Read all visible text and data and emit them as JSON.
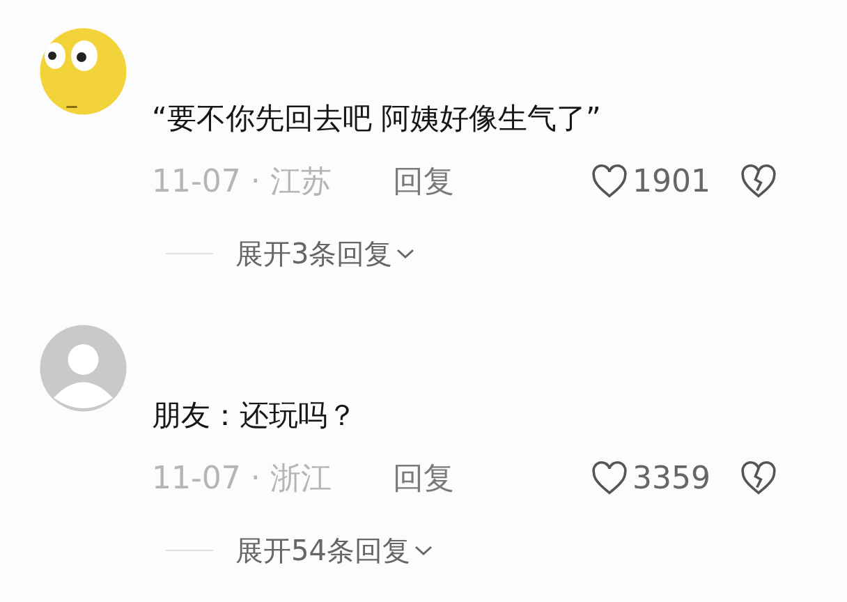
{
  "comments": [
    {
      "kind": "emoji",
      "text": "“要不你先回去吧 阿姨好像生气了”",
      "meta": "11-07 · 江苏",
      "reply": "回复",
      "likes": "1901",
      "expand": "展开3条回复"
    },
    {
      "kind": "default",
      "text": "朋友：还玩吗？",
      "meta": "11-07 · 浙江",
      "reply": "回复",
      "likes": "3359",
      "expand": "展开54条回复"
    }
  ]
}
